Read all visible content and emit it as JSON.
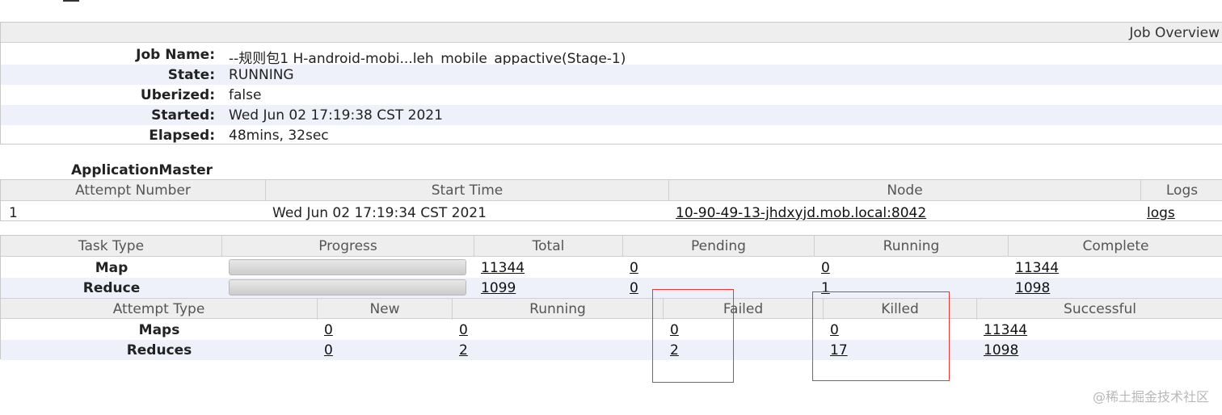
{
  "overview": {
    "header_title": "Job Overview",
    "rows": [
      {
        "label": "Job Name:",
        "value": "--规则包1 H-android-mobi...leh_mobile_appactive(Stage-1)"
      },
      {
        "label": "State:",
        "value": "RUNNING"
      },
      {
        "label": "Uberized:",
        "value": "false"
      },
      {
        "label": "Started:",
        "value": "Wed Jun 02 17:19:38 CST 2021"
      },
      {
        "label": "Elapsed:",
        "value": "48mins, 32sec"
      }
    ]
  },
  "application_master": {
    "title": "ApplicationMaster",
    "columns": [
      "Attempt Number",
      "Start Time",
      "Node",
      "Logs"
    ],
    "row": {
      "attempt_number": "1",
      "start_time": "Wed Jun 02 17:19:34 CST 2021",
      "node": "10-90-49-13-jhdxyjd.mob.local:8042",
      "logs": "logs"
    }
  },
  "tasks": {
    "columns": [
      "Task Type",
      "Progress",
      "Total",
      "Pending",
      "Running",
      "Complete"
    ],
    "rows": [
      {
        "type": "Map",
        "progress": 1.0,
        "total": "11344",
        "pending": "0",
        "running": "0",
        "complete": "11344"
      },
      {
        "type": "Reduce",
        "progress": 1.0,
        "total": "1099",
        "pending": "0",
        "running": "1",
        "complete": "1098"
      }
    ]
  },
  "attempts": {
    "columns": [
      "Attempt Type",
      "New",
      "Running",
      "Failed",
      "Killed",
      "Successful"
    ],
    "rows": [
      {
        "type": "Maps",
        "new": "0",
        "running": "0",
        "failed": "0",
        "killed": "0",
        "successful": "11344"
      },
      {
        "type": "Reduces",
        "new": "0",
        "running": "2",
        "failed": "2",
        "killed": "17",
        "successful": "1098"
      }
    ]
  },
  "watermark": "@稀土掘金技术社区",
  "colors": {
    "highlight_box": "#e53935",
    "alt_row": "#eef1fa",
    "header_bg": "#eeeeee"
  }
}
